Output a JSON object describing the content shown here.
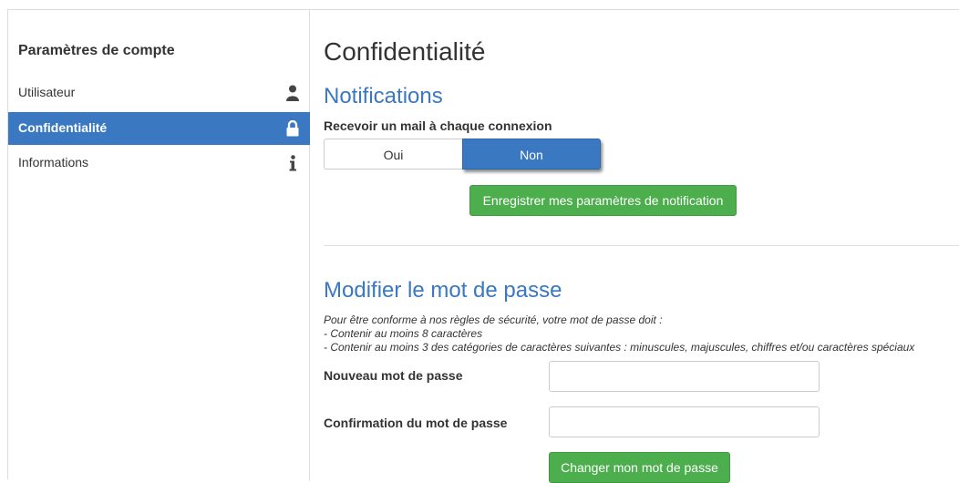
{
  "sidebar": {
    "title": "Paramètres de compte",
    "items": [
      {
        "label": "Utilisateur",
        "icon": "user-icon",
        "active": false
      },
      {
        "label": "Confidentialité",
        "icon": "lock-icon",
        "active": true
      },
      {
        "label": "Informations",
        "icon": "info-icon",
        "active": false
      }
    ]
  },
  "main": {
    "page_title": "Confidentialité",
    "notifications": {
      "title": "Notifications",
      "question": "Recevoir un mail à chaque connexion",
      "toggle": {
        "yes": "Oui",
        "no": "Non",
        "selected": "Non"
      },
      "save_button": "Enregistrer mes paramètres de notification"
    },
    "password": {
      "title": "Modifier le mot de passe",
      "rules": [
        "Pour être conforme à nos règles de sécurité, votre mot de passe doit :",
        "- Contenir au moins 8 caractères",
        "- Contenir au moins 3 des catégories de caractères suivantes : minuscules, majuscules, chiffres et/ou caractères spéciaux"
      ],
      "new_label": "Nouveau mot de passe",
      "new_value": "",
      "confirm_label": "Confirmation du mot de passe",
      "confirm_value": "",
      "change_button": "Changer mon mot de passe"
    }
  },
  "colors": {
    "accent": "#3a78c2",
    "success": "#4cae4c",
    "text": "#333333"
  }
}
